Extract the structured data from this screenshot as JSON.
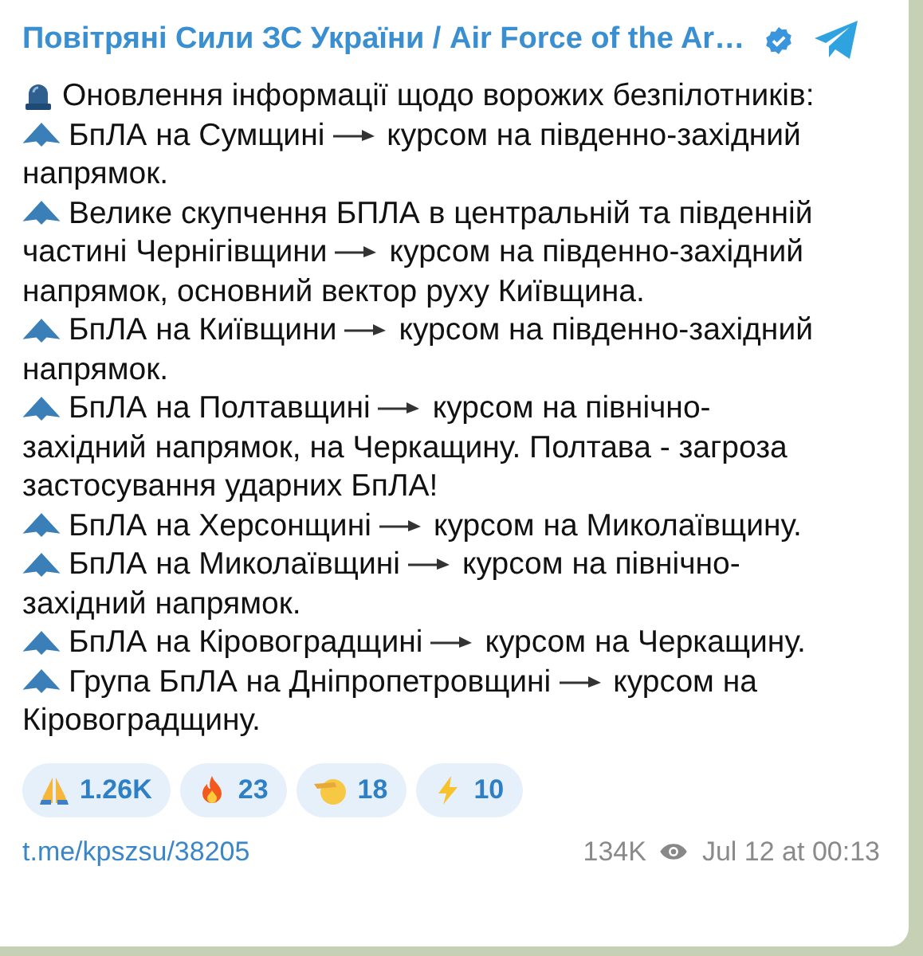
{
  "channel": {
    "title": "Повітряні Сили ЗС України / Air Force of the Ar…",
    "verified": true
  },
  "message": {
    "intro": "Оновлення інформації щодо ворожих безпілотників:",
    "items": [
      {
        "before": [
          "БпЛА на Сумщині"
        ],
        "after": [
          "курсом на південно-західний",
          "напрямок."
        ]
      },
      {
        "before": [
          "Велике скупчення БПЛА в центральній та південній",
          "частині Чернігівщини"
        ],
        "after": [
          "курсом на південно-західний",
          "напрямок, основний вектор руху Київщина."
        ]
      },
      {
        "before": [
          "БпЛА на Київщини"
        ],
        "after": [
          "курсом на південно-західний",
          "напрямок."
        ]
      },
      {
        "before": [
          "БпЛА на Полтавщині"
        ],
        "after": [
          "курсом на північно-",
          "західний напрямок, на Черкащину. Полтава - загроза",
          "застосування ударних БпЛА!"
        ]
      },
      {
        "before": [
          "БпЛА на Херсонщині"
        ],
        "after": [
          "курсом на Миколаївщину."
        ]
      },
      {
        "before": [
          "БпЛА на Миколаївщині"
        ],
        "after": [
          "курсом на північно-",
          "західний напрямок."
        ]
      },
      {
        "before": [
          "БпЛА на Кіровоградщині"
        ],
        "after": [
          "курсом на Черкащину."
        ]
      },
      {
        "before": [
          "Група БпЛА на Дніпропетровщині"
        ],
        "after": [
          "курсом на",
          "Кіровоградщину."
        ]
      }
    ]
  },
  "reactions": [
    {
      "kind": "pray",
      "count": "1.26K"
    },
    {
      "kind": "fire",
      "count": "23"
    },
    {
      "kind": "salute",
      "count": "18"
    },
    {
      "kind": "zap",
      "count": "10"
    }
  ],
  "footer": {
    "link": "t.me/kpszsu/38205",
    "views": "134K",
    "date": "Jul 12 at 00:13"
  }
}
